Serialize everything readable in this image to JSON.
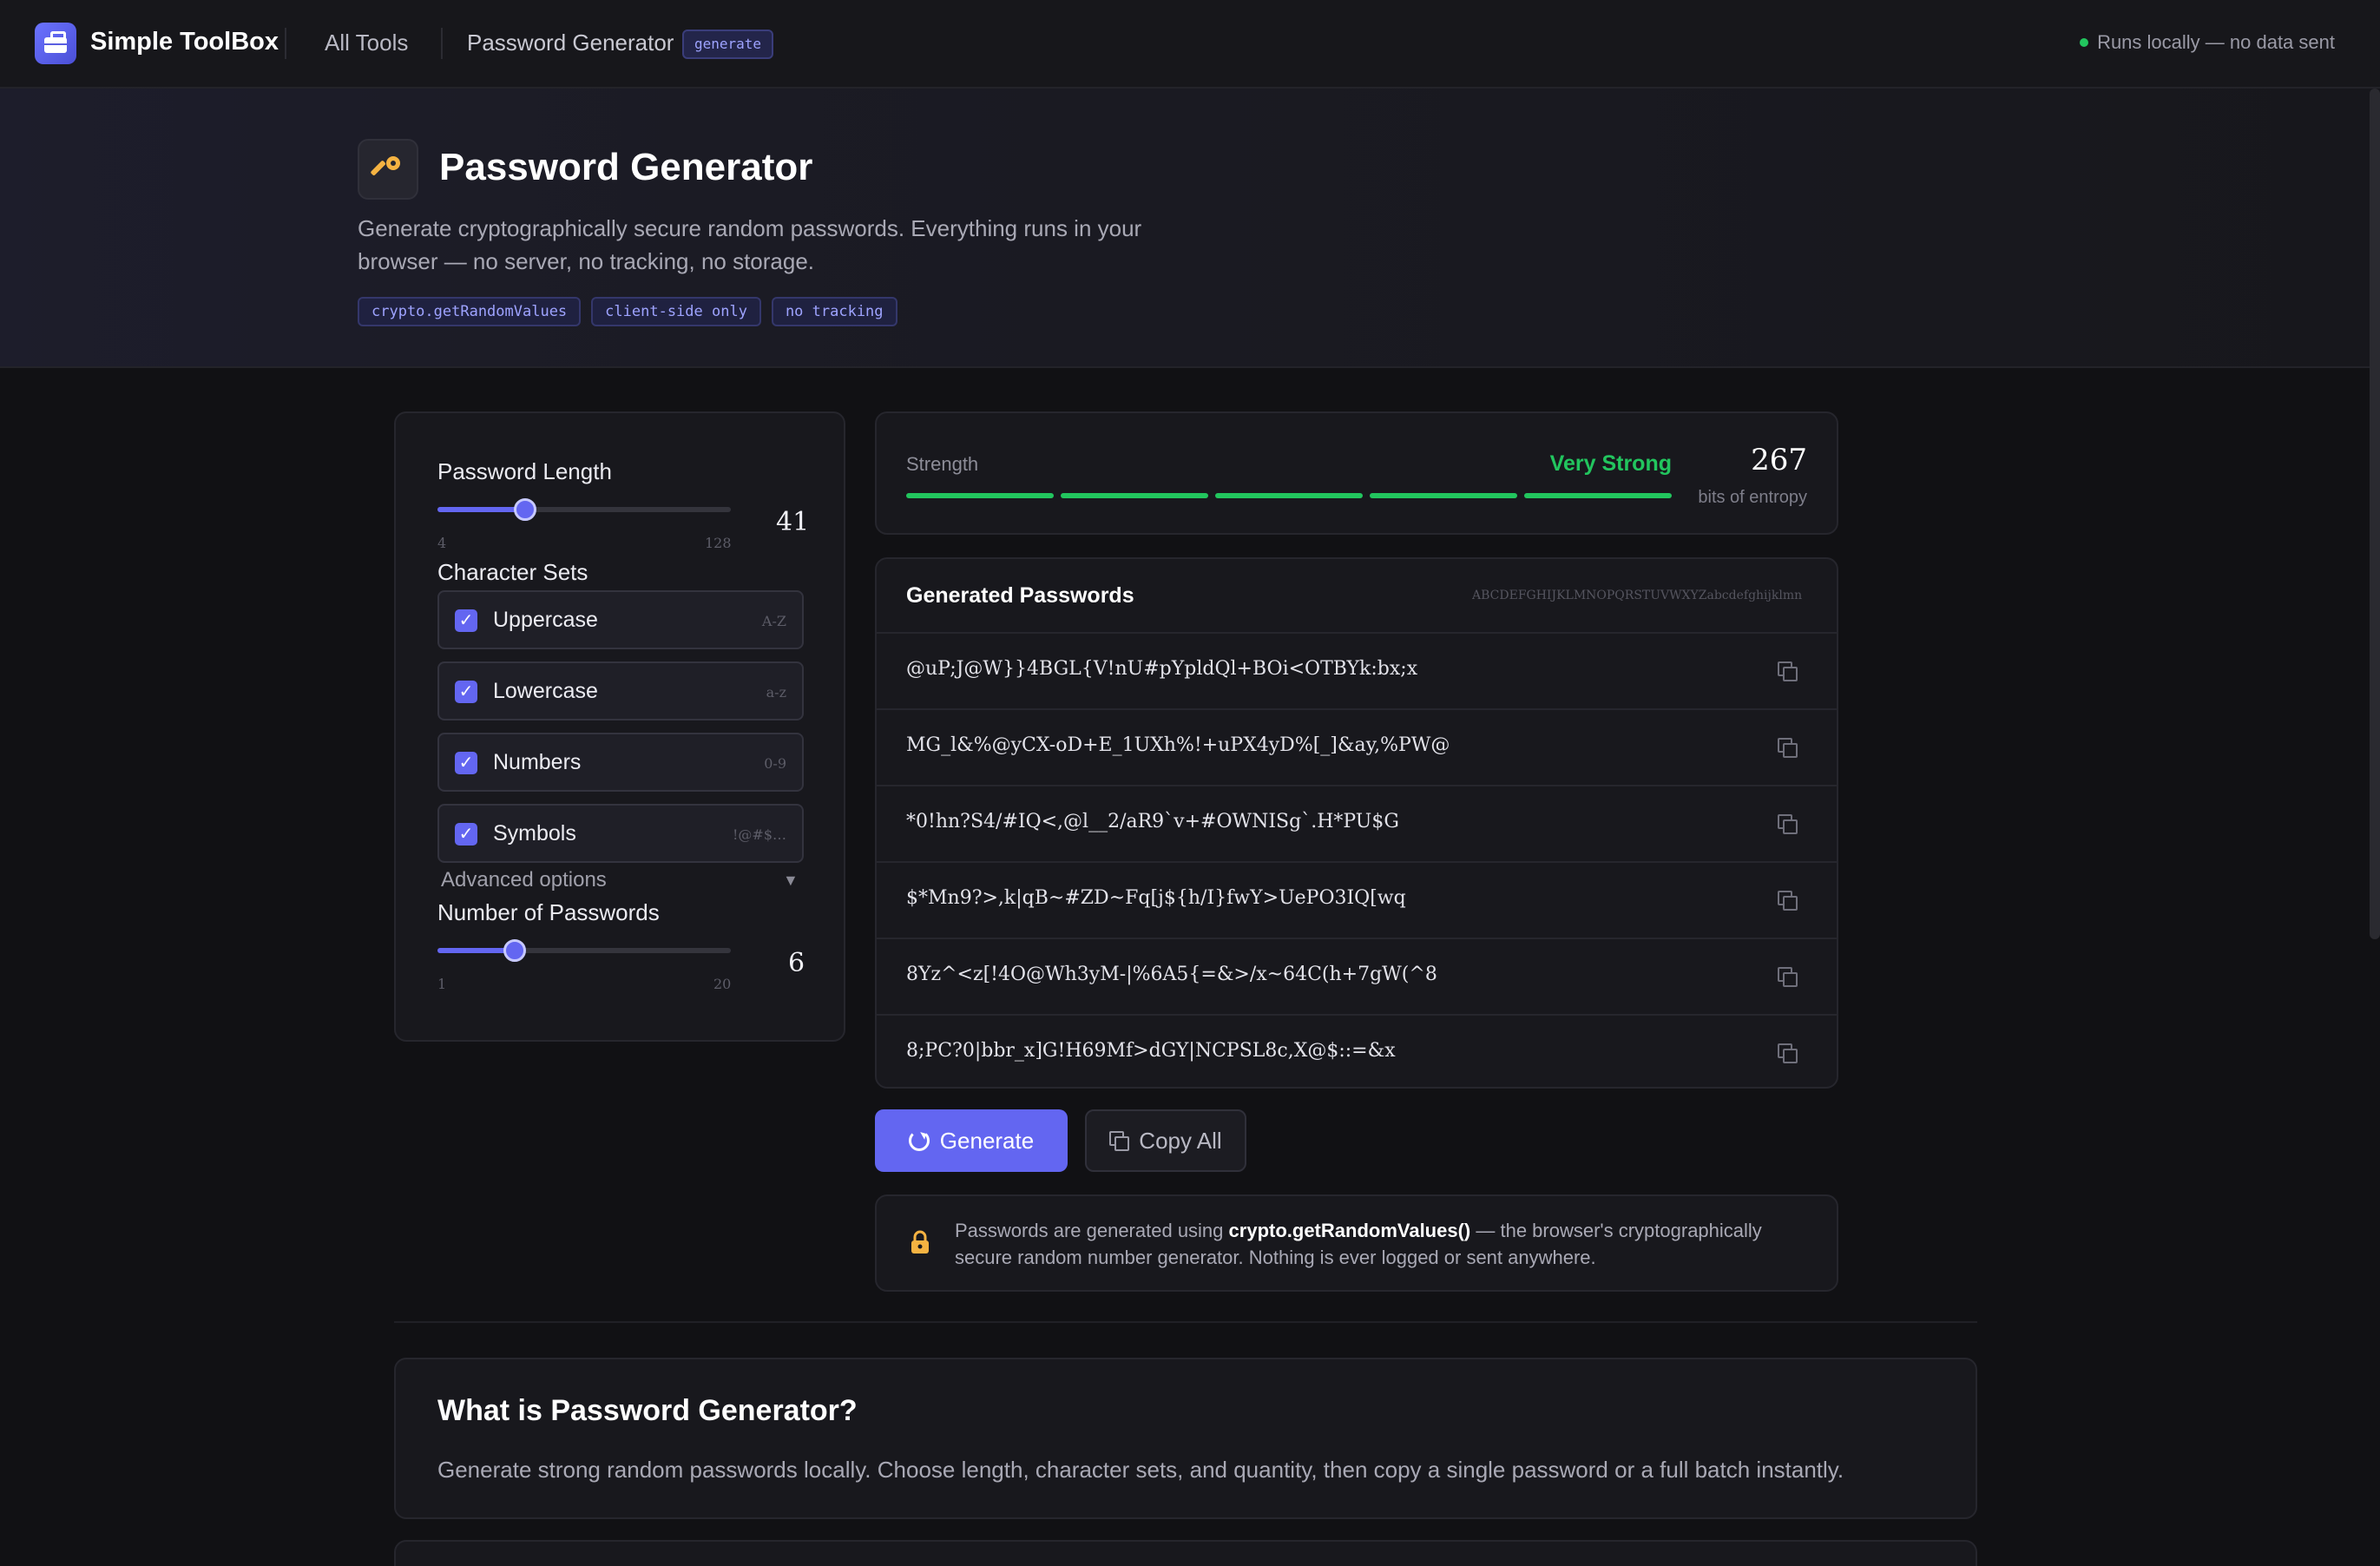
{
  "header": {
    "brand": "Simple ToolBox",
    "nav_all_tools": "All Tools",
    "breadcrumb_current": "Password Generator",
    "breadcrumb_badge": "generate",
    "local_status": "Runs locally — no data sent"
  },
  "hero": {
    "icon": "key-icon",
    "title": "Password Generator",
    "description": "Generate cryptographically secure random passwords. Everything runs in your browser — no server, no tracking, no storage.",
    "tags": [
      "crypto.getRandomValues",
      "client-side only",
      "no tracking"
    ]
  },
  "settings": {
    "length_label": "Password Length",
    "length_value": 41,
    "length_min": "4",
    "length_max": "128",
    "charsets_label": "Character Sets",
    "charsets": [
      {
        "name": "Uppercase",
        "hint": "A-Z",
        "checked": true
      },
      {
        "name": "Lowercase",
        "hint": "a-z",
        "checked": true
      },
      {
        "name": "Numbers",
        "hint": "0-9",
        "checked": true
      },
      {
        "name": "Symbols",
        "hint": "!@#$…",
        "checked": true
      }
    ],
    "advanced_label": "Advanced options",
    "count_label": "Number of Passwords",
    "count_value": 6,
    "count_min": "1",
    "count_max": "20"
  },
  "strength": {
    "label": "Strength",
    "value": "Very Strong",
    "bits": "267",
    "bits_label": "bits of entropy",
    "segments_filled": 5,
    "segments_total": 5,
    "color": "#22c55e"
  },
  "passwords": {
    "title": "Generated Passwords",
    "charset_preview": "ABCDEFGHIJKLMNOPQRSTUVWXYZabcdefghijklmn…",
    "items": [
      "@uP;J@W}}4BGL{V!nU#pYpldQl+BOi<OTBYk:bx;x",
      "MG_l&%@yCX-oD+E_1UXh%!+uPX4yD%[_]&ay,%PW@",
      "*0!hn?S4/#IQ<,@l__2/aR9`v+#OWNISg`.H*PU$G",
      "$*Mn9?>,k|qB~#ZD~Fq[j${h/I}fwY>UePO3IQ[wq",
      "8Yz^<z[!4O@Wh3yM-|%6A5{=&>/x~64C(h+7gW(^8",
      "8;PC?0|bbr_x]G!H69Mf>dGY|NCPSL8c,X@$::=&x"
    ]
  },
  "actions": {
    "generate": "Generate",
    "copy_all": "Copy All"
  },
  "info": {
    "prefix": "Passwords are generated using ",
    "api": "crypto.getRandomValues()",
    "suffix": " — the browser's cryptographically secure random number generator. Nothing is ever logged or sent anywhere."
  },
  "about": {
    "title": "What is Password Generator?",
    "text": "Generate strong random passwords locally. Choose length, character sets, and quantity, then copy a single password or a full batch instantly."
  }
}
